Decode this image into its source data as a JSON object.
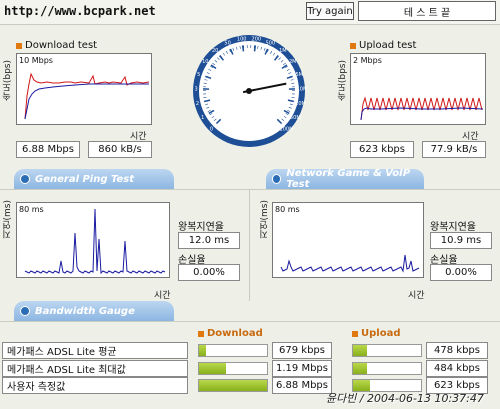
{
  "header": {
    "logo": "http://www.bcpark.net",
    "try_again": "Try again",
    "status": "테 스 트   끝"
  },
  "download": {
    "title": "Download test",
    "axis_label": "속도(bps)",
    "scale": "10 Mbps",
    "x_label": "시간",
    "speed_bps": "6.88 Mbps",
    "speed_Bps": "860 kB/s"
  },
  "upload": {
    "title": "Upload test",
    "axis_label": "속도(bps)",
    "scale": "2 Mbps",
    "x_label": "시간",
    "speed_bps": "623 kbps",
    "speed_Bps": "77.9 kB/s"
  },
  "speedometer": {
    "ticks": [
      "0",
      "1",
      "2",
      "3",
      "5",
      "10",
      "20",
      "50",
      "100",
      "200",
      "500",
      "1M",
      "2M",
      "5M",
      "10M",
      "20M",
      "50M",
      "100M"
    ],
    "needle_value_mbps": 6.88
  },
  "tabs": {
    "ping": "General Ping Test",
    "game": "Network Game & VoIP Test",
    "bandwidth": "Bandwidth Gauge"
  },
  "ping": {
    "axis_label": "지연(ms)",
    "scale": "80 ms",
    "x_label": "시간",
    "rtt_label": "왕복지연율",
    "rtt_value": "12.0 ms",
    "loss_label": "손실율",
    "loss_value": "0.00%"
  },
  "game": {
    "axis_label": "지연(ms)",
    "scale": "80 ms",
    "x_label": "시간",
    "rtt_label": "왕복지연율",
    "rtt_value": "10.9 ms",
    "loss_label": "손실율",
    "loss_value": "0.00%"
  },
  "gauge": {
    "download_header": "Download",
    "upload_header": "Upload",
    "rows": [
      {
        "label": "메가패스 ADSL Lite 평균",
        "down": "679 kbps",
        "down_frac": 0.1,
        "up": "478 kbps",
        "up_frac": 0.2
      },
      {
        "label": "메가패스 ADSL Lite 최대값",
        "down": "1.19 Mbps",
        "down_frac": 0.4,
        "up": "484 kbps",
        "up_frac": 0.2
      },
      {
        "label": "사용자 측정값",
        "down": "6.88 Mbps",
        "down_frac": 1.0,
        "up": "623 kbps",
        "up_frac": 0.25
      }
    ]
  },
  "footer": {
    "timestamp": "윤다빈 / 2004-06-13 10:37:47"
  },
  "colors": {
    "accent_orange": "#e07a10",
    "tab_blue": "#8db6e2",
    "gauge_green": "#9cc22c",
    "line_red": "#d01818",
    "line_blue": "#1a1aa0"
  }
}
